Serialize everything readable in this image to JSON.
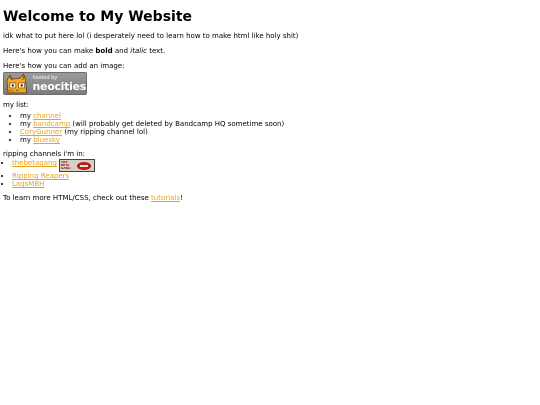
{
  "heading": "Welcome to My Website",
  "intro": "idk what to put here lol (i desperately need to learn how to make html like holy shit)",
  "formatting": {
    "prefix": "Here's how you can make ",
    "bold": "bold",
    "middle": " and ",
    "italic": "italic",
    "suffix": " text."
  },
  "image_line": "Here's how you can add an image:",
  "neocities_badge": {
    "small_text": "hosted by",
    "big_text": "neocities"
  },
  "list_label": "my list:",
  "my_list": [
    {
      "prefix": "my ",
      "link": "channel",
      "suffix": ""
    },
    {
      "prefix": "my ",
      "link": "bandcamp",
      "suffix": " (will probably get deleted by Bandcamp HQ sometime soon)"
    },
    {
      "prefix": "",
      "link": "CoryGunner",
      "suffix": " (my ripping channel lol)"
    },
    {
      "prefix": "my ",
      "link": "bluesky",
      "suffix": ""
    }
  ],
  "ripping_label": "ripping channels i'm in:",
  "ripping_list": [
    {
      "link": "thebetagang"
    },
    {
      "link": "Ripping Reapers"
    },
    {
      "link": "LagsMBH"
    }
  ],
  "ripping_badge": {
    "text": "THE BETA GANG"
  },
  "footer": {
    "prefix": "To learn more HTML/CSS, check out these ",
    "link": "tutorials",
    "suffix": "!"
  },
  "colors": {
    "link": "#e8a317",
    "background": "#ffffff",
    "text": "#000000"
  }
}
